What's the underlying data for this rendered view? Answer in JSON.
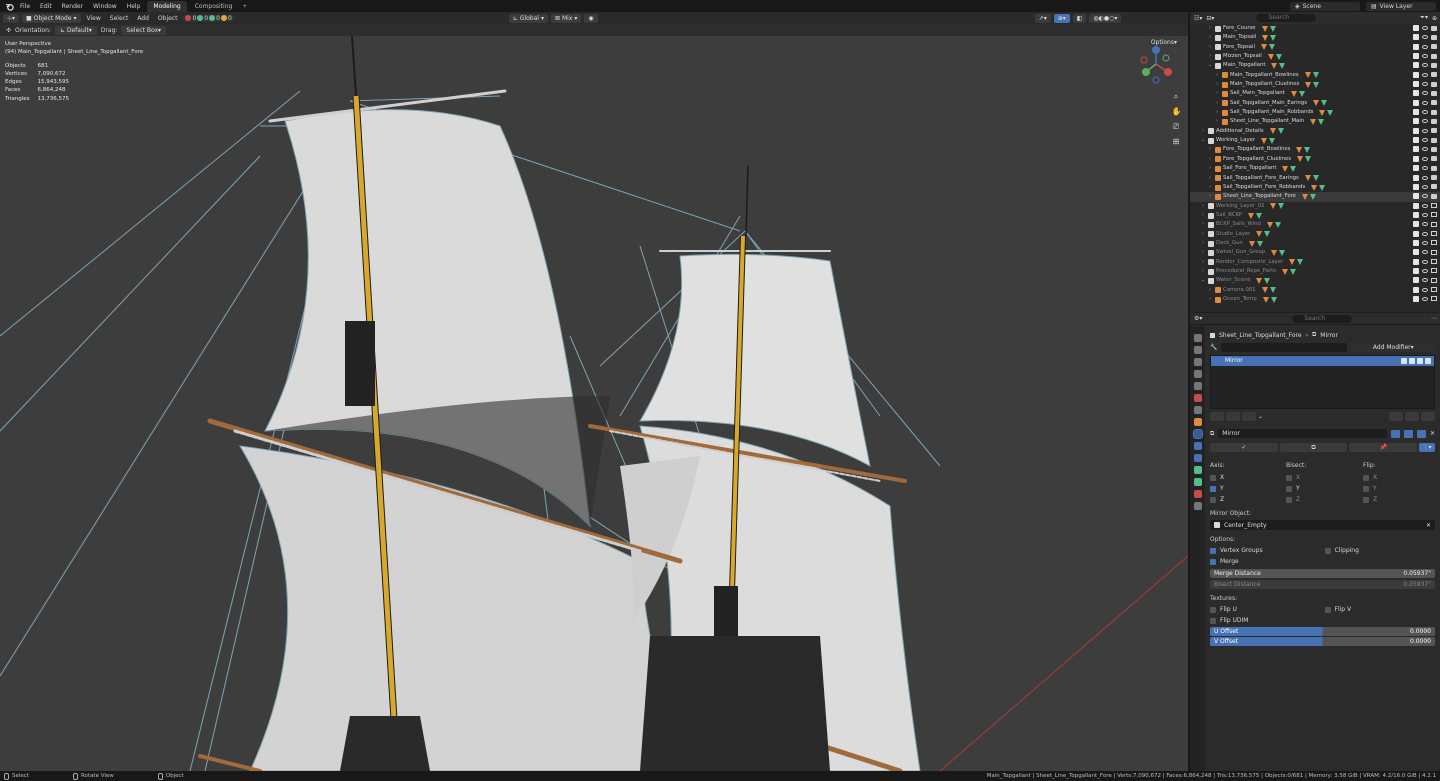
{
  "topbar": {
    "menus": [
      "File",
      "Edit",
      "Render",
      "Window",
      "Help"
    ],
    "workspaces": [
      "Modeling",
      "Compositing"
    ],
    "active_workspace": "Modeling",
    "scene": "Scene",
    "view_layer": "View Layer"
  },
  "viewport": {
    "mode": "Object Mode",
    "menus": [
      "View",
      "Select",
      "Add",
      "Object"
    ],
    "counts": [
      "0",
      "0",
      "0",
      "0"
    ],
    "orientation_label": "Orientation:",
    "orientation_value": "Default",
    "drag_label": "Drag:",
    "drag_value": "Select Box",
    "transform": "Global",
    "pivot": "Mix",
    "options": "Options",
    "perspective": "User Perspective",
    "active_info": "(94) Main_Topgallant | Sheet_Line_Topgallant_Fore",
    "stats": [
      {
        "label": "Objects",
        "value": "681"
      },
      {
        "label": "Vertices",
        "value": "7,090,672"
      },
      {
        "label": "Edges",
        "value": "15,943,595"
      },
      {
        "label": "Faces",
        "value": "6,864,248"
      },
      {
        "label": "Triangles",
        "value": "13,736,575"
      }
    ]
  },
  "outliner": {
    "search_placeholder": "Search",
    "rows": [
      {
        "name": "Fore_Course",
        "type": "coll",
        "indent": 1,
        "vis": "full"
      },
      {
        "name": "Main_Topsail",
        "type": "coll",
        "indent": 1,
        "vis": "full"
      },
      {
        "name": "Fore_Topsail",
        "type": "coll",
        "indent": 1,
        "vis": "full"
      },
      {
        "name": "Mizzen_Topsail",
        "type": "coll",
        "indent": 1,
        "vis": "full"
      },
      {
        "name": "Main_Topgallant",
        "type": "coll",
        "indent": 1,
        "vis": "full",
        "open": true
      },
      {
        "name": "Main_Topgallant_Bowlines",
        "type": "obj",
        "indent": 2,
        "vis": "full"
      },
      {
        "name": "Main_Topgallant_Cluelines",
        "type": "obj",
        "indent": 2,
        "vis": "full"
      },
      {
        "name": "Sail_Main_Topgallant",
        "type": "obj",
        "indent": 2,
        "vis": "full"
      },
      {
        "name": "Sail_Topgallant_Main_Earings",
        "type": "obj",
        "indent": 2,
        "vis": "full"
      },
      {
        "name": "Sail_Topgallant_Main_Robbands",
        "type": "obj",
        "indent": 2,
        "vis": "full"
      },
      {
        "name": "Sheet_Line_Topgallant_Main",
        "type": "obj",
        "indent": 2,
        "vis": "full"
      },
      {
        "name": "Additional_Details",
        "type": "coll",
        "indent": 0,
        "vis": "full"
      },
      {
        "name": "Working_Layer",
        "type": "coll",
        "indent": 0,
        "vis": "full",
        "open": true
      },
      {
        "name": "Fore_Topgallant_Bowlines",
        "type": "obj",
        "indent": 1,
        "vis": "full"
      },
      {
        "name": "Fore_Topgallant_Cluelines",
        "type": "obj",
        "indent": 1,
        "vis": "full"
      },
      {
        "name": "Sail_Fore_Topgallant",
        "type": "obj",
        "indent": 1,
        "vis": "full"
      },
      {
        "name": "Sail_Topgallant_Fore_Earings",
        "type": "obj",
        "indent": 1,
        "vis": "full"
      },
      {
        "name": "Sail_Topgallant_Fore_Robbands",
        "type": "obj",
        "indent": 1,
        "vis": "full"
      },
      {
        "name": "Sheet_Line_Topgallant_Fore",
        "type": "obj",
        "indent": 1,
        "vis": "full",
        "selected": true
      },
      {
        "name": "Working_Layer_02",
        "type": "coll",
        "indent": 0,
        "vis": "dim"
      },
      {
        "name": "Sail_BCKP",
        "type": "coll",
        "indent": 0,
        "vis": "dim"
      },
      {
        "name": "BCKP_Sails_Wind",
        "type": "coll",
        "indent": 0,
        "vis": "dim"
      },
      {
        "name": "Studio_Layer",
        "type": "coll",
        "indent": 0,
        "vis": "dim"
      },
      {
        "name": "Deck_Gun",
        "type": "coll",
        "indent": 0,
        "vis": "dim"
      },
      {
        "name": "Swivel_Gun_Group",
        "type": "coll",
        "indent": 0,
        "vis": "dim"
      },
      {
        "name": "Render_Composite_Layer",
        "type": "coll",
        "indent": 0,
        "vis": "dim"
      },
      {
        "name": "Procedural_Rope_Parts",
        "type": "coll",
        "indent": 0,
        "vis": "dim"
      },
      {
        "name": "Water_Scene",
        "type": "coll",
        "indent": 0,
        "vis": "dim",
        "open": true
      },
      {
        "name": "Camera.001",
        "type": "obj",
        "indent": 1,
        "vis": "dim"
      },
      {
        "name": "Ocean_Temp",
        "type": "obj",
        "indent": 1,
        "vis": "dim"
      }
    ]
  },
  "properties": {
    "search_placeholder": "Search",
    "breadcrumb_object": "Sheet_Line_Topgallant_Fore",
    "breadcrumb_modifier": "Mirror",
    "add_modifier": "Add Modifier",
    "modifier_list_item": "Mirror",
    "modifier_name": "Mirror",
    "axis_label": "Axis:",
    "bisect_label": "Bisect:",
    "flip_label": "Flip:",
    "axes": [
      "X",
      "Y",
      "Z"
    ],
    "axis_checked": [
      false,
      true,
      false
    ],
    "mirror_object_label": "Mirror Object:",
    "mirror_object": "Center_Empty",
    "options_label": "Options:",
    "vertex_groups": "Vertex Groups",
    "clipping": "Clipping",
    "merge": "Merge",
    "merge_distance_label": "Merge Distance",
    "merge_distance_value": "0.05937\"",
    "bisect_distance_label": "Bisect Distance",
    "bisect_distance_value": "0.05937\"",
    "textures_label": "Textures:",
    "flip_u": "Flip U",
    "flip_v": "Flip V",
    "flip_udim": "Flip UDIM",
    "u_offset_label": "U Offset",
    "u_offset_value": "0.0000",
    "v_offset_label": "V Offset",
    "v_offset_value": "0.0000"
  },
  "status": {
    "select": "Select",
    "rotate": "Rotate View",
    "object": "Object",
    "info": "Main_Topgallant | Sheet_Line_Topgallant_Fore | Verts:7,090,672 | Faces:6,864,248 | Tris:13,736,575 | Objects:0/681 | Memory: 3.58 GiB | VRAM: 4.2/16.0 GiB | 4.2.1"
  },
  "colors": {
    "accent": "#4772b3",
    "viewport_bg": "#3d3d3d",
    "mast_yellow": "#d9a82a",
    "sail": "#dcdcdc",
    "rope_blue": "#7fa3b5"
  }
}
